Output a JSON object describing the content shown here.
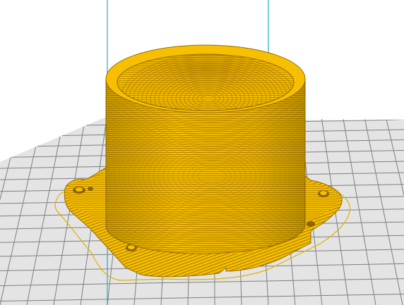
{
  "viewport": {
    "background_color": "#ffffff"
  },
  "build_plate": {
    "fill_color": "#e4e4e4",
    "grid_color": "#7f7f7f"
  },
  "axis_lines": {
    "color": "#24a5d4"
  },
  "model_outline": {
    "color": "#e0b000"
  },
  "sliced_model": {
    "name_icon": "cylinder-with-square-flange",
    "body_color": "#f6c000",
    "layer_line_color": "#c08c00",
    "shadow_color": "#8a6400"
  }
}
